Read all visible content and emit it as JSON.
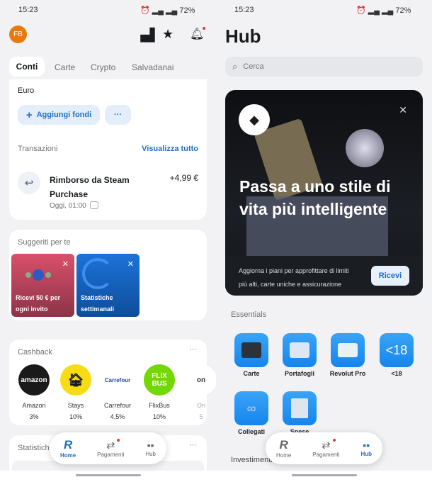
{
  "status": {
    "time": "15:23",
    "battery": "72%"
  },
  "home": {
    "avatar": "FB",
    "tabs": [
      "Conti",
      "Carte",
      "Crypto",
      "Salvadanai"
    ],
    "account": {
      "currency": "Euro",
      "add_funds": "Aggiungi fondi",
      "more": "···"
    },
    "transactions": {
      "title": "Transazioni",
      "view_all": "Visualizza tutto",
      "items": [
        {
          "title_line1": "Rimborso da Steam",
          "title_line2": "Purchase",
          "time": "Oggi, 01:00",
          "amount": "+4,99 €"
        }
      ]
    },
    "suggested": {
      "title": "Suggeriti per te",
      "tiles": [
        {
          "line1": "Ricevi 50 € per",
          "line2": "ogni invito",
          "color": "#c0435f"
        },
        {
          "line1": "Statistiche",
          "line2": "settimanali",
          "color": "#1560b8"
        }
      ]
    },
    "cashback": {
      "title": "Cashback",
      "items": [
        {
          "name": "Amazon",
          "pct": "3%",
          "logo": "amazon"
        },
        {
          "name": "Stays",
          "pct": "10%"
        },
        {
          "name": "Carrefour",
          "pct": "4,5%",
          "logo": "Carrefour"
        },
        {
          "name": "FlixBus",
          "pct": "10%",
          "logo_l1": "FLiX",
          "logo_l2": "BUS"
        },
        {
          "name": "On",
          "pct": "5",
          "logo": "on"
        }
      ]
    },
    "stats": {
      "title": "Statistich"
    }
  },
  "nav": {
    "home": "Home",
    "payments": "Pagamenti",
    "hub": "Hub"
  },
  "hub": {
    "title": "Hub",
    "search_placeholder": "Cerca",
    "promo": {
      "title_line1": "Passa a uno stile di",
      "title_line2": "vita più intelligente",
      "desc_line1": "Aggiorna i piani per approfittare di limiti",
      "desc_line2": "più alti, carte uniche e assicurazione",
      "cta": "Ricevi"
    },
    "essentials_title": "Essentials",
    "essentials": [
      "Carte",
      "Portafogli",
      "Revolut Pro",
      "<18",
      "Collegati",
      "Spese"
    ],
    "investments_title": "Investimenti"
  },
  "colors": {
    "accent": "#1f6fc6",
    "avatar": "#e8790f",
    "notification": "#e5373f"
  }
}
